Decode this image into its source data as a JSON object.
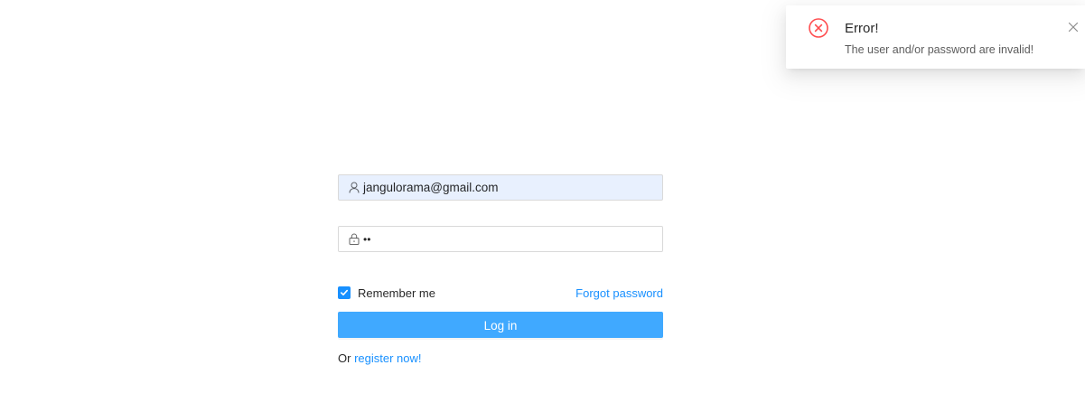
{
  "notification": {
    "title": "Error!",
    "description": "The user and/or password are invalid!",
    "icon": "close-circle-icon",
    "close_icon": "close-icon",
    "error_color": "#ff4d4f"
  },
  "login_form": {
    "email": {
      "value": "jangulorama@gmail.com",
      "icon": "user-icon"
    },
    "password": {
      "masked_value": "••",
      "icon": "lock-icon"
    },
    "remember_me": {
      "label": "Remember me",
      "checked": true
    },
    "forgot_password_label": "Forgot password",
    "login_button_label": "Log in",
    "register_prefix": "Or ",
    "register_link_label": "register now!"
  },
  "colors": {
    "primary": "#1890ff",
    "button": "#40a9ff",
    "autofill_background": "#e8f0fe"
  }
}
